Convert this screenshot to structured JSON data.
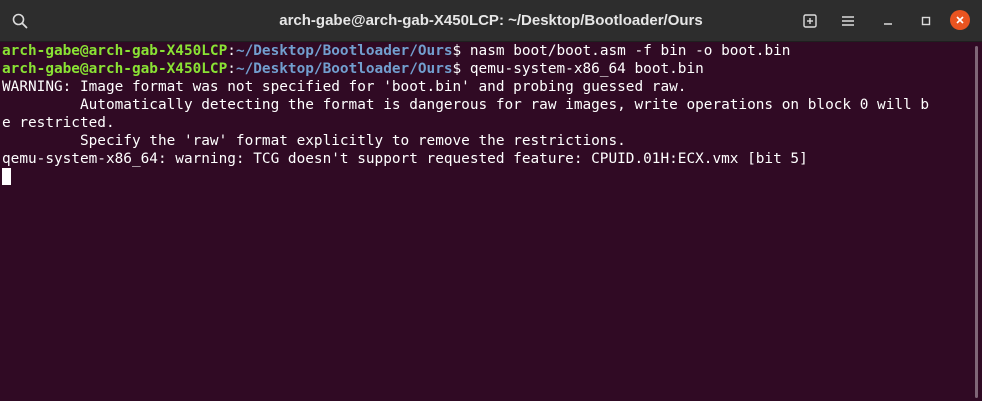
{
  "window": {
    "title": "arch-gabe@arch-gab-X450LCP: ~/Desktop/Bootloader/Ours"
  },
  "titlebar": {
    "icons": {
      "search": "search-icon",
      "new_tab": "new-tab-icon",
      "menu": "hamburger-menu-icon",
      "minimize": "minimize-icon",
      "maximize": "maximize-icon",
      "close": "close-icon"
    }
  },
  "terminal": {
    "prompt1": {
      "user": "arch-gabe@arch-gab-X450LCP",
      "sep": ":",
      "path": "~/Desktop/Bootloader/Ours",
      "symbol": "$ ",
      "command": "nasm boot/boot.asm -f bin -o boot.bin"
    },
    "prompt2": {
      "user": "arch-gabe@arch-gab-X450LCP",
      "sep": ":",
      "path": "~/Desktop/Bootloader/Ours",
      "symbol": "$ ",
      "command": "qemu-system-x86_64 boot.bin"
    },
    "output": [
      "WARNING: Image format was not specified for 'boot.bin' and probing guessed raw.",
      "         Automatically detecting the format is dangerous for raw images, write operations on block 0 will b",
      "e restricted.",
      "         Specify the 'raw' format explicitly to remove the restrictions.",
      "qemu-system-x86_64: warning: TCG doesn't support requested feature: CPUID.01H:ECX.vmx [bit 5]"
    ]
  },
  "colors": {
    "background": "#300a24",
    "titlebar": "#2d2d2d",
    "user": "#8ae234",
    "path": "#729fcf",
    "close_button": "#e95420"
  }
}
